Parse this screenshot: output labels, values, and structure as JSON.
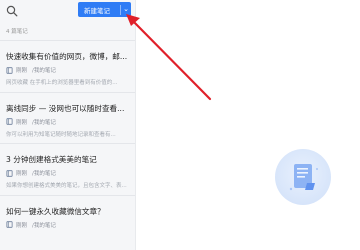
{
  "toolbar": {
    "search_icon": "search-icon",
    "new_note_label": "新建笔记",
    "dropdown_icon": "chevron-down-icon"
  },
  "notes": {
    "count_label": "4 篇笔记",
    "items": [
      {
        "title": "快速收集有价值的网页，微博，邮...",
        "time": "刚刚",
        "folder": "/我的笔记",
        "snippet": "网页收藏 在手机上的浏览器里看到有价值的..."
      },
      {
        "title": "离线同步 — 没网也可以随时查看...",
        "time": "刚刚",
        "folder": "/我的笔记",
        "snippet": "你可以利用为知笔记随时随地记录和查看有..."
      },
      {
        "title": "3 分钟创建格式美美的笔记",
        "time": "刚刚",
        "folder": "/我的笔记",
        "snippet": "如果你想创建格式美美的笔记，且包含文字、表..."
      },
      {
        "title": "如何一键永久收藏微信文章？",
        "time": "刚刚",
        "folder": "/我的笔记",
        "snippet": ""
      }
    ]
  },
  "colors": {
    "accent": "#2f7cf5",
    "annotation_arrow": "#e0202a",
    "sidebar_bg": "#f5f6f8"
  },
  "empty_state_icon": "document-illustration-icon"
}
